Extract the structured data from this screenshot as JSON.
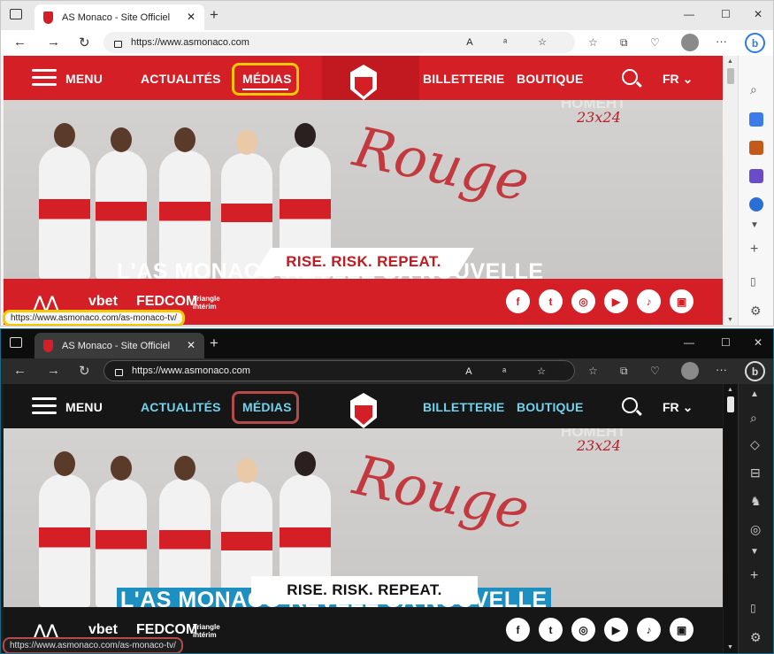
{
  "windows": [
    {
      "theme": "light",
      "tab": {
        "title": "AS Monaco - Site Officiel"
      },
      "address": {
        "url": "https://www.asmonaco.com"
      },
      "site": {
        "menu_label": "MENU",
        "nav": [
          "ACTUALITÉS",
          "MÉDIAS",
          "BILLETTERIE",
          "BOUTIQUE"
        ],
        "lang": "FR",
        "hero": {
          "script_text": "Rouge",
          "year_text": "23x24",
          "ghost_text": "HOMEHT",
          "headline": "L'AS MONACO RÉVÈLE SA NOUVELLE",
          "tagline": "RISE. RISK. REPEAT."
        },
        "sponsors": [
          "vbet",
          "FEDCOM",
          "Triangle Intérim"
        ],
        "social": [
          "f",
          "t",
          "ig",
          "yt",
          "tt",
          "tw"
        ]
      },
      "status_url": "https://www.asmonaco.com/as-monaco-tv/",
      "colors": {
        "brand": "#d51f26",
        "highlight": "#f5c800"
      }
    },
    {
      "theme": "dark",
      "tab": {
        "title": "AS Monaco - Site Officiel"
      },
      "address": {
        "url": "https://www.asmonaco.com"
      },
      "site": {
        "menu_label": "MENU",
        "nav": [
          "ACTUALITÉS",
          "MÉDIAS",
          "BILLETTERIE",
          "BOUTIQUE"
        ],
        "lang": "FR",
        "hero": {
          "script_text": "Rouge",
          "year_text": "23x24",
          "ghost_text": "HOMEHT",
          "headline": "L'AS MONACO RÉVÈLE SA NOUVELLE",
          "tagline": "RISE. RISK. REPEAT."
        },
        "sponsors": [
          "vbet",
          "FEDCOM",
          "Triangle Intérim"
        ],
        "social": [
          "f",
          "t",
          "ig",
          "yt",
          "tt",
          "tw"
        ]
      },
      "status_url": "https://www.asmonaco.com/as-monaco-tv/",
      "colors": {
        "brand": "#161616",
        "accent": "#6fd3ee",
        "highlight": "#b34b4b"
      }
    }
  ]
}
